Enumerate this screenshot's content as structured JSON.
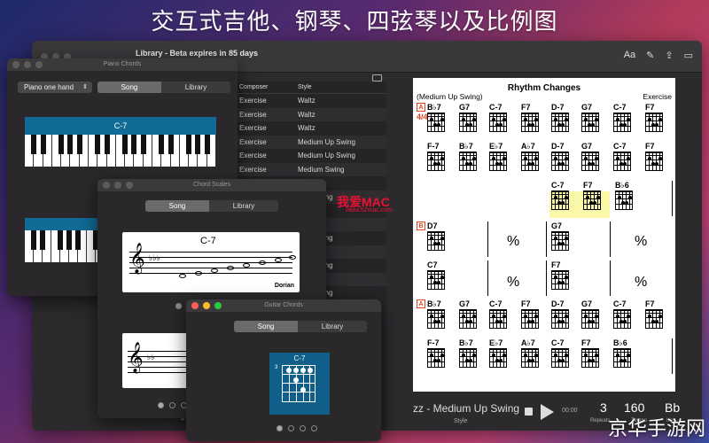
{
  "banner": "交互式吉他、钢琴、四弦琴以及比例图",
  "main_window": {
    "title": "Library - Beta expires in 85 days",
    "toolbar_icons": [
      "font-size-icon",
      "pencil-icon",
      "share-icon",
      "sidebar-icon"
    ],
    "font_icon_text": "Aa",
    "columns": [
      "Composer",
      "Style"
    ],
    "rows": [
      {
        "composer": "Exercise",
        "style": "Waltz"
      },
      {
        "composer": "Exercise",
        "style": "Waltz"
      },
      {
        "composer": "Exercise",
        "style": "Waltz"
      },
      {
        "composer": "Exercise",
        "style": "Medium Up Swing"
      },
      {
        "composer": "Exercise",
        "style": "Medium Up Swing"
      },
      {
        "composer": "Exercise",
        "style": "Medium Swing"
      },
      {
        "composer": "",
        "style": "ths"
      },
      {
        "composer": "",
        "style": "mpo Swing"
      },
      {
        "composer": "",
        "style": "Swing"
      },
      {
        "composer": "",
        "style": "Swing"
      },
      {
        "composer": "",
        "style": "mpo Swing"
      },
      {
        "composer": "",
        "style": "Swing"
      },
      {
        "composer": "",
        "style": "mpo Swing"
      },
      {
        "composer": "",
        "style": "ths"
      },
      {
        "composer": "",
        "style": "mpo Swing"
      }
    ],
    "bottom_text": "Trane Chang"
  },
  "sheet": {
    "title": "Rhythm Changes",
    "style": "(Medium Up Swing)",
    "composer": "Exercise",
    "time_sig": "4/4",
    "sections": [
      "A",
      "B",
      "A"
    ],
    "row1": [
      "B♭7",
      "G7",
      "C-7",
      "F7",
      "D-7",
      "G7",
      "C-7",
      "F7"
    ],
    "row2": [
      "F-7",
      "B♭7",
      "E♭7",
      "A♭7",
      "D-7",
      "G7",
      "C-7",
      "F7"
    ],
    "row3": [
      "C-7",
      "F7",
      "B♭6"
    ],
    "rowB1": [
      "D7",
      "G7"
    ],
    "rowB2": [
      "C7",
      "F7"
    ],
    "row5": [
      "B♭7",
      "G7",
      "C-7",
      "F7",
      "D-7",
      "G7",
      "C-7",
      "F7"
    ],
    "row6": [
      "F-7",
      "B♭7",
      "E♭7",
      "A♭7",
      "C-7",
      "F7",
      "B♭6"
    ]
  },
  "player": {
    "song": "zz - Medium Up Swing",
    "style_label": "Style",
    "time": "00:00",
    "repeats": "3",
    "repeats_label": "Repeats",
    "tempo": "160",
    "tempo_label": "Tempo",
    "key": "Bb",
    "key_label": "Key"
  },
  "piano_window": {
    "title": "Piano Chords",
    "mode": "Piano one hand",
    "tabs": [
      "Song",
      "Library"
    ],
    "chord": "C-7"
  },
  "scales_window": {
    "title": "Chord Scales",
    "tabs": [
      "Song",
      "Library"
    ],
    "chord": "C-7",
    "scale": "Dorian"
  },
  "guitar_window": {
    "title": "Guitar Chords",
    "tabs": [
      "Song",
      "Library"
    ],
    "chord": "C-7",
    "fret_number": "3"
  },
  "watermark": "京华手游网",
  "watermark2": "我爱MAC",
  "watermark2_url": "www.52mac.com",
  "colors": {
    "accent_blue": "#116b96",
    "section_red": "#dd4422",
    "highlight": "#fbf7a8"
  }
}
